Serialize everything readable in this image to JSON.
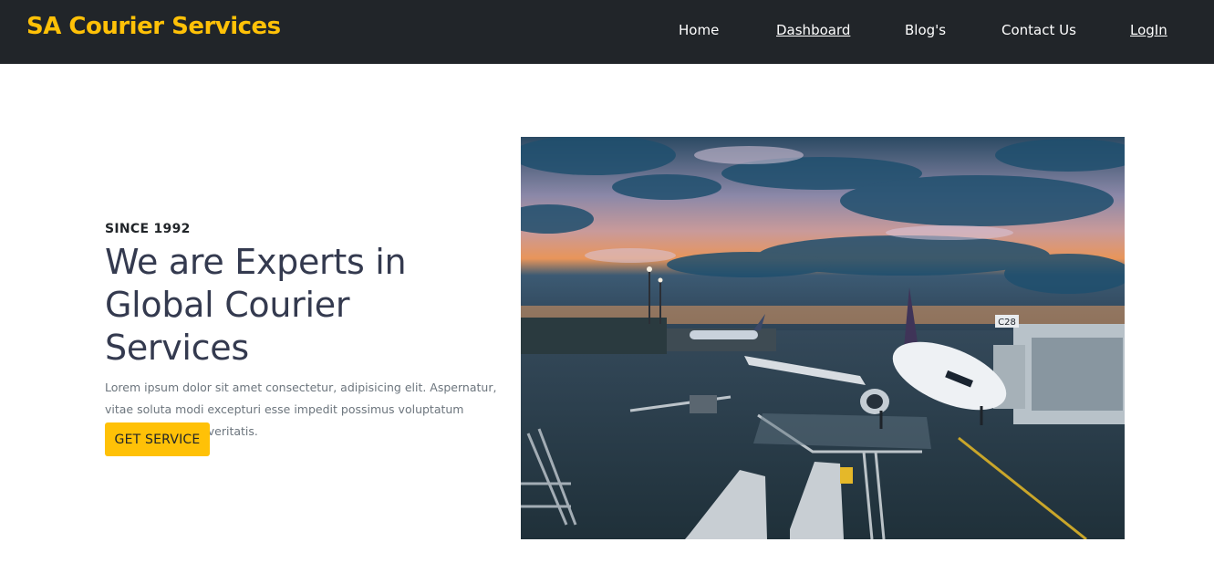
{
  "navbar": {
    "brand": "SA Courier Services",
    "links": [
      {
        "label": "Home"
      },
      {
        "label": "Dashboard"
      },
      {
        "label": "Blog's"
      },
      {
        "label": "Contact Us"
      },
      {
        "label": "LogIn"
      }
    ]
  },
  "hero": {
    "eyebrow": "SINCE 1992",
    "title_line1": "We are Experts in",
    "title_line2": "Global Courier Services",
    "description": "Lorem ipsum dolor sit amet consectetur, adipisicing elit. Aspernatur, vitae soluta modi excepturi esse impedit possimus voluptatum quidem doloribus veritatis.",
    "button_label": "GET SERVICE",
    "gate_sign": "C28"
  },
  "colors": {
    "navbar_bg": "#212529",
    "brand": "#ffc107",
    "button_bg": "#ffc107",
    "headline": "#343a4f",
    "body_text": "#6c757d"
  }
}
